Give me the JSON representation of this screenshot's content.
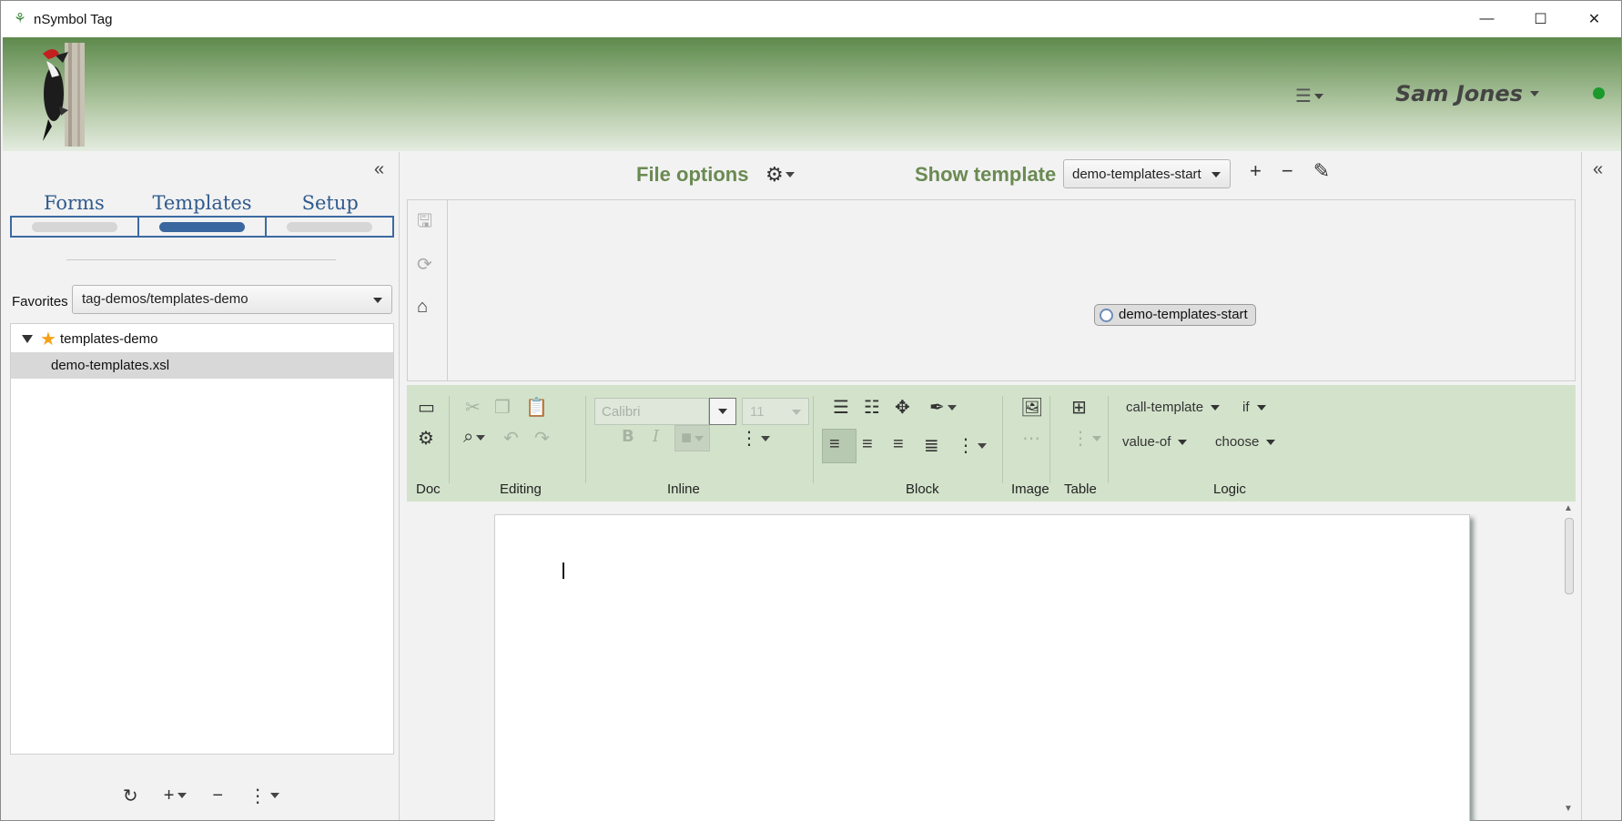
{
  "window": {
    "title": "nSymbol Tag",
    "minimize": "—",
    "maximize": "☐",
    "close": "✕"
  },
  "header": {
    "user_name": "Sam Jones",
    "status_color": "#1a9a2a"
  },
  "left_panel": {
    "tabs": [
      {
        "label": "Forms"
      },
      {
        "label": "Templates"
      },
      {
        "label": "Setup"
      }
    ],
    "active_tab": "Templates",
    "favorites_label": "Favorites",
    "favorites_value": "tag-demos/templates-demo",
    "tree": [
      {
        "label": "templates-demo",
        "type": "folder",
        "starred": true,
        "expanded": true
      },
      {
        "label": "demo-templates.xsl",
        "type": "file",
        "selected": true
      }
    ]
  },
  "top_bar": {
    "file_options": "File options",
    "show_template": "Show template",
    "template_value": "demo-templates-start"
  },
  "diagram": {
    "node_label": "demo-templates-start"
  },
  "ribbon": {
    "font_name": "Calibri",
    "font_size": "11",
    "groups": [
      {
        "label": "Doc"
      },
      {
        "label": "Editing"
      },
      {
        "label": "Inline"
      },
      {
        "label": "Block"
      },
      {
        "label": "Image"
      },
      {
        "label": "Table"
      },
      {
        "label": "Logic"
      }
    ],
    "logic_items": [
      {
        "label": "call-template"
      },
      {
        "label": "if"
      },
      {
        "label": "value-of"
      },
      {
        "label": "choose"
      }
    ]
  },
  "colors": {
    "accent_green": "#6a8a52",
    "tab_blue": "#2f5a8c",
    "ribbon_bg": "#d3e3cb"
  }
}
